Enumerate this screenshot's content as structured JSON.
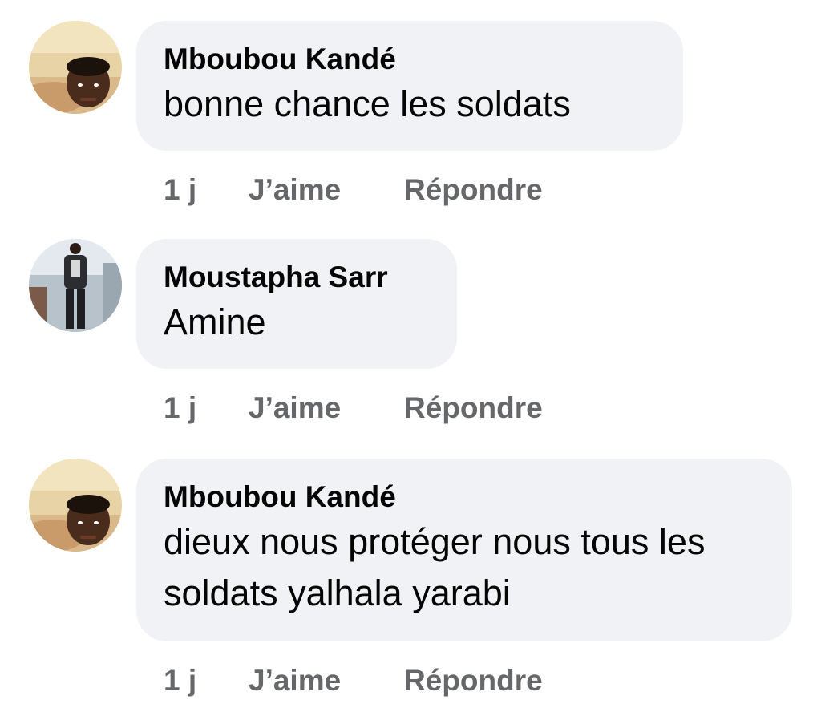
{
  "comments": [
    {
      "author": "Mboubou Kandé",
      "text": "bonne chance les soldats",
      "time": "1 j",
      "like_label": "J’aime",
      "reply_label": "Répondre"
    },
    {
      "author": "Moustapha Sarr",
      "text": "Amine",
      "time": "1 j",
      "like_label": "J’aime",
      "reply_label": "Répondre"
    },
    {
      "author": "Mboubou Kandé",
      "text": "dieux nous protéger nous tous les soldats yalhala yarabi",
      "time": "1 j",
      "like_label": "J’aime",
      "reply_label": "Répondre"
    }
  ]
}
